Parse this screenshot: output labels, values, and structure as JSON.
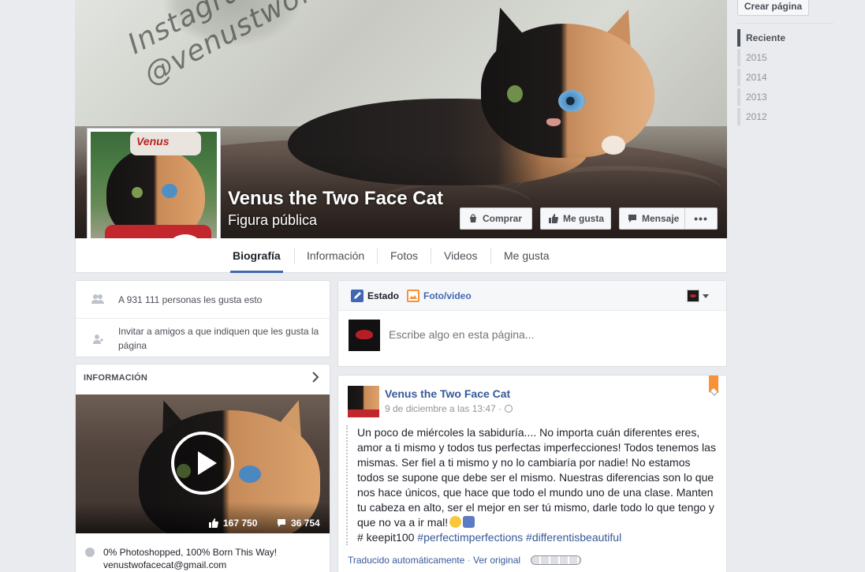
{
  "header": {
    "create_page": "Crear página"
  },
  "cover": {
    "watermark_line1": "Instagram & Twitter",
    "watermark_line2": "@venustwofacecat",
    "page_name": "Venus the Two Face Cat",
    "page_category": "Figura pública",
    "buttons": {
      "buy": "Comprar",
      "like": "Me gusta",
      "message": "Mensaje",
      "more": "•••"
    },
    "profile_hat_text": "Venus"
  },
  "tabs": [
    {
      "label": "Biografía",
      "active": true
    },
    {
      "label": "Información"
    },
    {
      "label": "Fotos"
    },
    {
      "label": "Videos"
    },
    {
      "label": "Me gusta"
    }
  ],
  "timeline_years": [
    {
      "label": "Reciente",
      "active": true
    },
    {
      "label": "2015"
    },
    {
      "label": "2014"
    },
    {
      "label": "2013"
    },
    {
      "label": "2012"
    }
  ],
  "likes_card": {
    "likes_text": "A 931 111 personas les gusta esto",
    "invite_text": "Invitar a amigos a que indiquen que les gusta la página"
  },
  "info_card": {
    "heading": "INFORMACIÓN",
    "video_likes": "167 750",
    "video_comments": "36 754",
    "bio": "0% Photoshopped, 100% Born This Way!",
    "email": "venustwofacecat@gmail.com"
  },
  "composer": {
    "tab_status": "Estado",
    "tab_photo": "Foto/video",
    "placeholder": "Escribe algo en esta página..."
  },
  "post": {
    "author": "Venus the Two Face Cat",
    "time": "9 de diciembre a las 13:47 ·",
    "body": "Un poco de miércoles la sabiduría.... No importa cuán diferentes eres, amor a ti mismo y todos tus perfectas imperfecciones! Todos tenemos las mismas. Ser fiel a ti mismo y no lo cambiaría por nadie! No estamos todos se supone que debe ser el mismo. Nuestras diferencias son lo que nos hace únicos, que hace que todo el mundo uno de una clase. Manten tu cabeza en alto, ser el mejor en ser tú mismo, darle todo lo que tengo y que no va a ir mal!",
    "tags_prefix": "# keepit100",
    "hashtag1": "#perfectimperfections",
    "hashtag2": "#differentisbeautiful",
    "translated": "Traducido automáticamente",
    "separator": "·",
    "see_original": "Ver original"
  },
  "colors": {
    "accent": "#4267b2",
    "link": "#365899",
    "background": "#e9ebee",
    "photo_tab": "#f7923a"
  }
}
